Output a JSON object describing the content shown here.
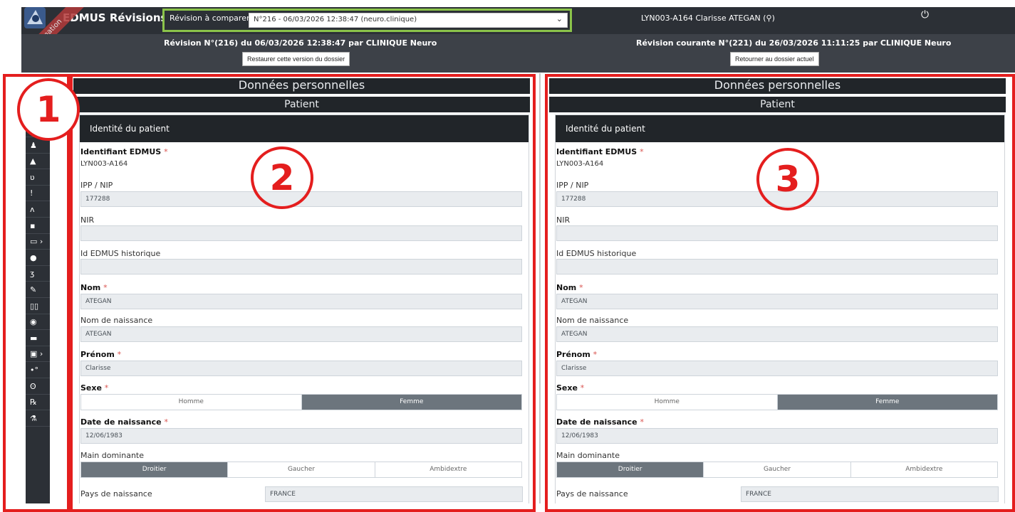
{
  "header": {
    "app_name": "EDMUS Révisions",
    "ribbon": "Formation",
    "revision_select_label": "Révision à comparer",
    "revision_select_value": "N°216 - 06/03/2026 12:38:47 (neuro.clinique)",
    "user_info": "LYN003-A164  Clarisse  ATEGAN (⚲)",
    "power_icon": "power-icon"
  },
  "revision_bar": {
    "left_title": "Révision N°(216) du 06/03/2026 12:38:47 par CLINIQUE Neuro",
    "left_button": "Restaurer cette version du dossier",
    "right_title": "Révision courante N°(221) du 26/03/2026 11:11:25 par CLINIQUE Neuro",
    "right_button": "Retourner au dossier actuel"
  },
  "sidebar": {
    "items": [
      {
        "icon": "users-icon",
        "glyph": "👥"
      },
      {
        "icon": "person-icon",
        "glyph": "♟"
      },
      {
        "icon": "warning-icon",
        "glyph": "▲"
      },
      {
        "icon": "stethoscope-icon",
        "glyph": "ʋ"
      },
      {
        "icon": "exclamation-icon",
        "glyph": "!"
      },
      {
        "icon": "walking-icon",
        "glyph": "ᴧ"
      },
      {
        "icon": "file-plus-icon",
        "glyph": "▪"
      },
      {
        "icon": "document-icon",
        "glyph": "▭ ›"
      },
      {
        "icon": "brain-icon",
        "glyph": "●"
      },
      {
        "icon": "ear-icon",
        "glyph": "ʒ"
      },
      {
        "icon": "syringe-icon",
        "glyph": "✎"
      },
      {
        "icon": "vials-icon",
        "glyph": "▯▯"
      },
      {
        "icon": "eye-icon",
        "glyph": "◉"
      },
      {
        "icon": "bed-icon",
        "glyph": "▬"
      },
      {
        "icon": "trash-icon",
        "glyph": "▣ ›"
      },
      {
        "icon": "pills-icon",
        "glyph": "•°"
      },
      {
        "icon": "capsules-icon",
        "glyph": "ʘ"
      },
      {
        "icon": "prescription-icon",
        "glyph": "℞"
      },
      {
        "icon": "flask-icon",
        "glyph": "⚗"
      }
    ]
  },
  "panel": {
    "section_title": "Données personnelles",
    "subsection_title": "Patient",
    "card_title": "Identité du patient",
    "required_mark": "*",
    "labels": {
      "edmus_id": "Identifiant EDMUS",
      "ipp": "IPP / NIP",
      "nir": "NIR",
      "edmus_hist": "Id EDMUS historique",
      "nom": "Nom",
      "nom_naissance": "Nom de naissance",
      "prenom": "Prénom",
      "sexe": "Sexe",
      "date_naissance": "Date de naissance",
      "main": "Main dominante",
      "pays": "Pays de naissance"
    },
    "sexe_options": [
      "Homme",
      "Femme"
    ],
    "main_options": [
      "Droitier",
      "Gaucher",
      "Ambidextre"
    ]
  },
  "left_panel": {
    "edmus_id": "LYN003-A164",
    "ipp": "177288",
    "nir": "",
    "edmus_hist": "",
    "nom": "ATEGAN",
    "nom_naissance": "ATEGAN",
    "prenom": "Clarisse",
    "sexe_selected": "Femme",
    "date_naissance": "12/06/1983",
    "main_selected": "Droitier",
    "pays": "FRANCE"
  },
  "right_panel": {
    "edmus_id": "LYN003-A164",
    "ipp": "177288",
    "nir": "",
    "edmus_hist": "",
    "nom": "ATEGAN",
    "nom_naissance": "ATEGAN",
    "prenom": "Clarisse",
    "sexe_selected": "Femme",
    "date_naissance": "12/06/1983",
    "main_selected": "Droitier",
    "pays": "FRANCE"
  },
  "annotations": {
    "one": "1",
    "two": "2",
    "three": "3",
    "box_color": "#e41e1e",
    "highlight_color": "#8bc34a"
  }
}
